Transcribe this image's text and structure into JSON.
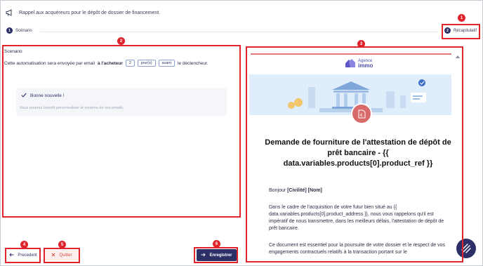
{
  "header": {
    "title": "Rappel aux acquéreurs pour le dépôt de dossier de financement."
  },
  "steps": [
    {
      "number": "1",
      "label": "Scénario"
    },
    {
      "number": "2",
      "label": "Récapitulatif"
    }
  ],
  "annotations": [
    "1",
    "2",
    "3",
    "4",
    "5",
    "6"
  ],
  "left_panel": {
    "heading": "Scenario",
    "sentence_prefix": "Cette automatisation sera envoyée par email",
    "recipient": "à l'acheteur",
    "delay_value": "2",
    "delay_unit": "jour(s)",
    "timing": "avant",
    "sentence_suffix": "le déclencheur.",
    "notice_title": "Bonne nouvelle !",
    "notice_text": "Vous pourrez bientôt personnaliser le contenu de vos emails."
  },
  "preview": {
    "logo_line1": "Agence",
    "logo_line2": "immo",
    "title": "Demande de fourniture de l'attestation de dépôt de prêt bancaire - {{ data.variables.products[0].product_ref }}",
    "greeting_prefix": "Bonjour",
    "greeting_vars": "[Civilité] [Nom]",
    "paragraph1": "Dans le cadre de l'acquisition de votre futur bien situé au {{ data.variables.products[0].product_address }}, nous vous rappelons qu'il est impératif de nous transmettre, dans les meilleurs délais, l'attestation de dépôt de prêt bancaire.",
    "paragraph2": "Ce document est essentiel pour la poursuite de votre dossier et le respect de vos engagements contractuels relatifs à la transaction portant sur le"
  },
  "footer": {
    "prev_label": "Precedent",
    "quit_label": "Quitter",
    "save_label": "Enregistrer"
  },
  "colors": {
    "primary": "#2c3066",
    "annotation_red": "#e0242b",
    "quit_red": "#d04848"
  }
}
